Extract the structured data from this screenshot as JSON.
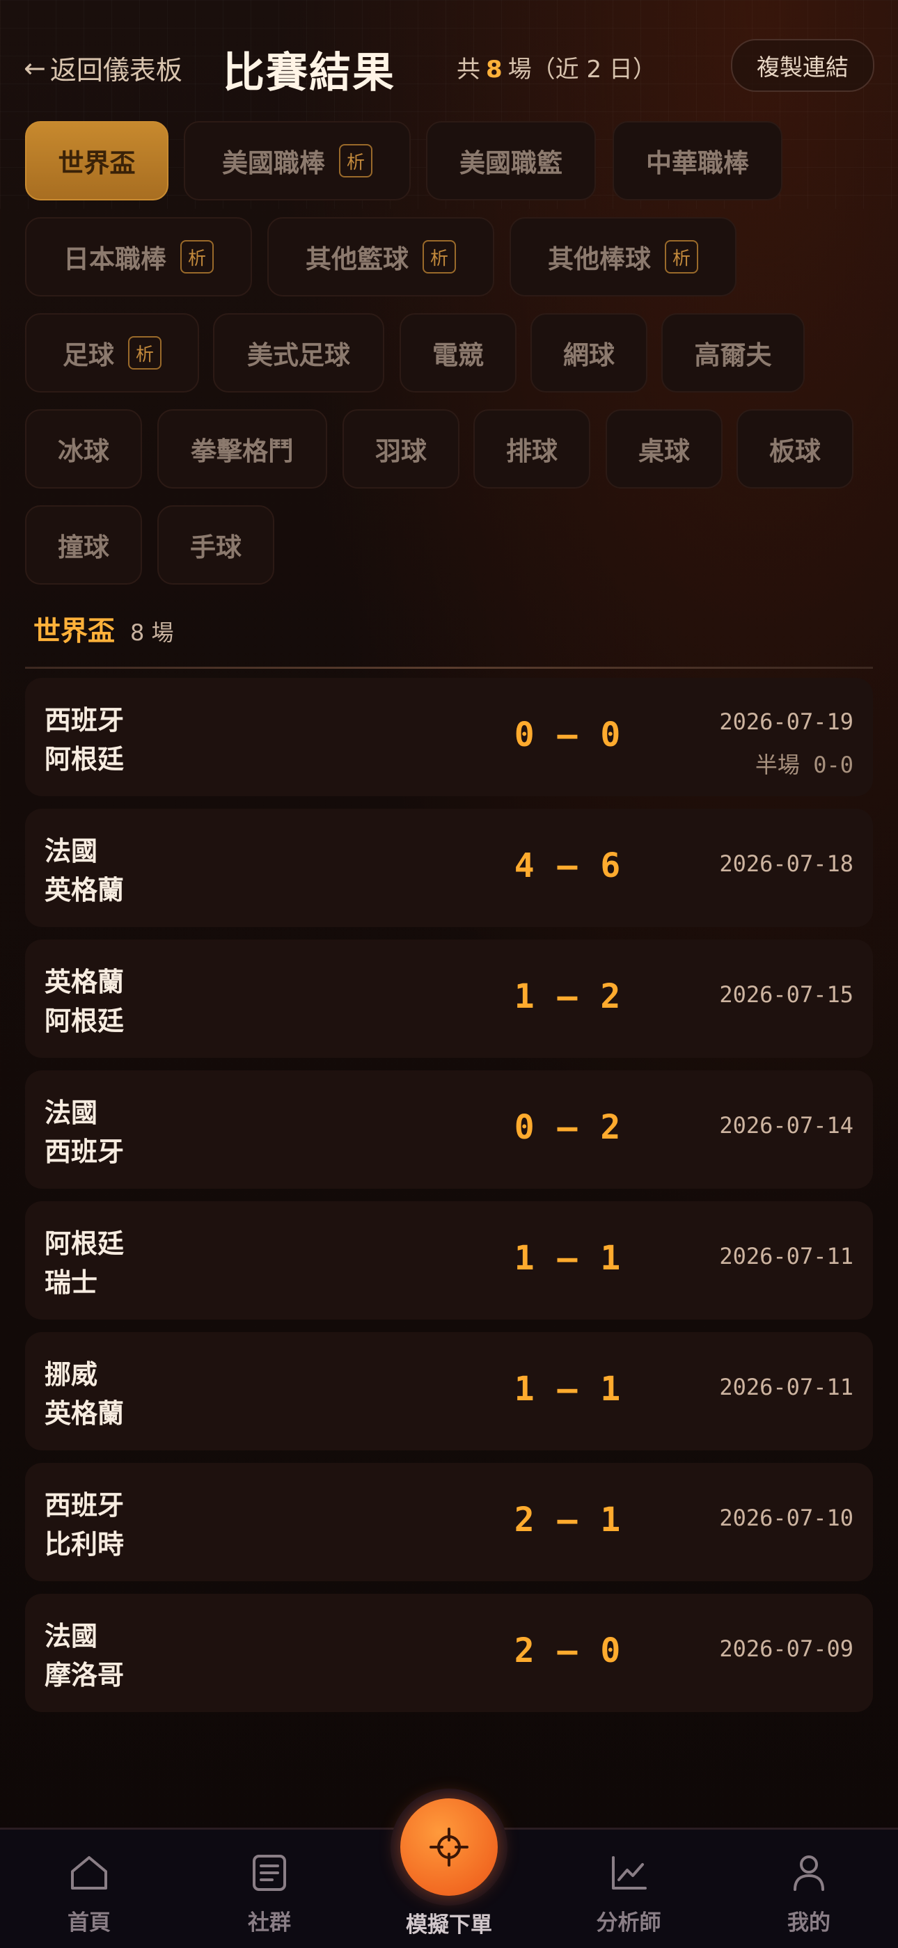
{
  "header": {
    "back_label": "返回儀表板",
    "title": "比賽結果",
    "count_prefix": "共",
    "count_value": "8",
    "count_suffix": "場（近 2 日）",
    "copy_label": "複製連結"
  },
  "chips": [
    {
      "label": "世界盃",
      "active": true,
      "badge": ""
    },
    {
      "label": "美國職棒",
      "active": false,
      "badge": "析"
    },
    {
      "label": "美國職籃",
      "active": false,
      "badge": ""
    },
    {
      "label": "中華職棒",
      "active": false,
      "badge": ""
    },
    {
      "label": "日本職棒",
      "active": false,
      "badge": "析"
    },
    {
      "label": "其他籃球",
      "active": false,
      "badge": "析"
    },
    {
      "label": "其他棒球",
      "active": false,
      "badge": "析"
    },
    {
      "label": "足球",
      "active": false,
      "badge": "析"
    },
    {
      "label": "美式足球",
      "active": false,
      "badge": ""
    },
    {
      "label": "電競",
      "active": false,
      "badge": ""
    },
    {
      "label": "網球",
      "active": false,
      "badge": ""
    },
    {
      "label": "高爾夫",
      "active": false,
      "badge": ""
    },
    {
      "label": "冰球",
      "active": false,
      "badge": ""
    },
    {
      "label": "拳擊格鬥",
      "active": false,
      "badge": ""
    },
    {
      "label": "羽球",
      "active": false,
      "badge": ""
    },
    {
      "label": "排球",
      "active": false,
      "badge": ""
    },
    {
      "label": "桌球",
      "active": false,
      "badge": ""
    },
    {
      "label": "板球",
      "active": false,
      "badge": ""
    },
    {
      "label": "撞球",
      "active": false,
      "badge": ""
    },
    {
      "label": "手球",
      "active": false,
      "badge": ""
    }
  ],
  "section": {
    "title": "世界盃",
    "count": "8 場"
  },
  "matches": [
    {
      "home": "西班牙",
      "away": "阿根廷",
      "score": "0 – 0",
      "date": "2026-07-19",
      "halftime": "半場 0-0"
    },
    {
      "home": "法國",
      "away": "英格蘭",
      "score": "4 – 6",
      "date": "2026-07-18",
      "halftime": ""
    },
    {
      "home": "英格蘭",
      "away": "阿根廷",
      "score": "1 – 2",
      "date": "2026-07-15",
      "halftime": ""
    },
    {
      "home": "法國",
      "away": "西班牙",
      "score": "0 – 2",
      "date": "2026-07-14",
      "halftime": ""
    },
    {
      "home": "阿根廷",
      "away": "瑞士",
      "score": "1 – 1",
      "date": "2026-07-11",
      "halftime": ""
    },
    {
      "home": "挪威",
      "away": "英格蘭",
      "score": "1 – 1",
      "date": "2026-07-11",
      "halftime": ""
    },
    {
      "home": "西班牙",
      "away": "比利時",
      "score": "2 – 1",
      "date": "2026-07-10",
      "halftime": ""
    },
    {
      "home": "法國",
      "away": "摩洛哥",
      "score": "2 – 0",
      "date": "2026-07-09",
      "halftime": ""
    }
  ],
  "nav": {
    "home": {
      "label": "首頁",
      "icon": "home-icon"
    },
    "community": {
      "label": "社群",
      "icon": "document-icon"
    },
    "simulate": {
      "label": "模擬下單",
      "icon": "crosshair-icon"
    },
    "analyst": {
      "label": "分析師",
      "icon": "chart-line-icon"
    },
    "mine": {
      "label": "我的",
      "icon": "user-icon"
    }
  },
  "colors": {
    "accent": "#ffb13a",
    "active_chip": "#c7892e",
    "fab": "#f26a22"
  }
}
